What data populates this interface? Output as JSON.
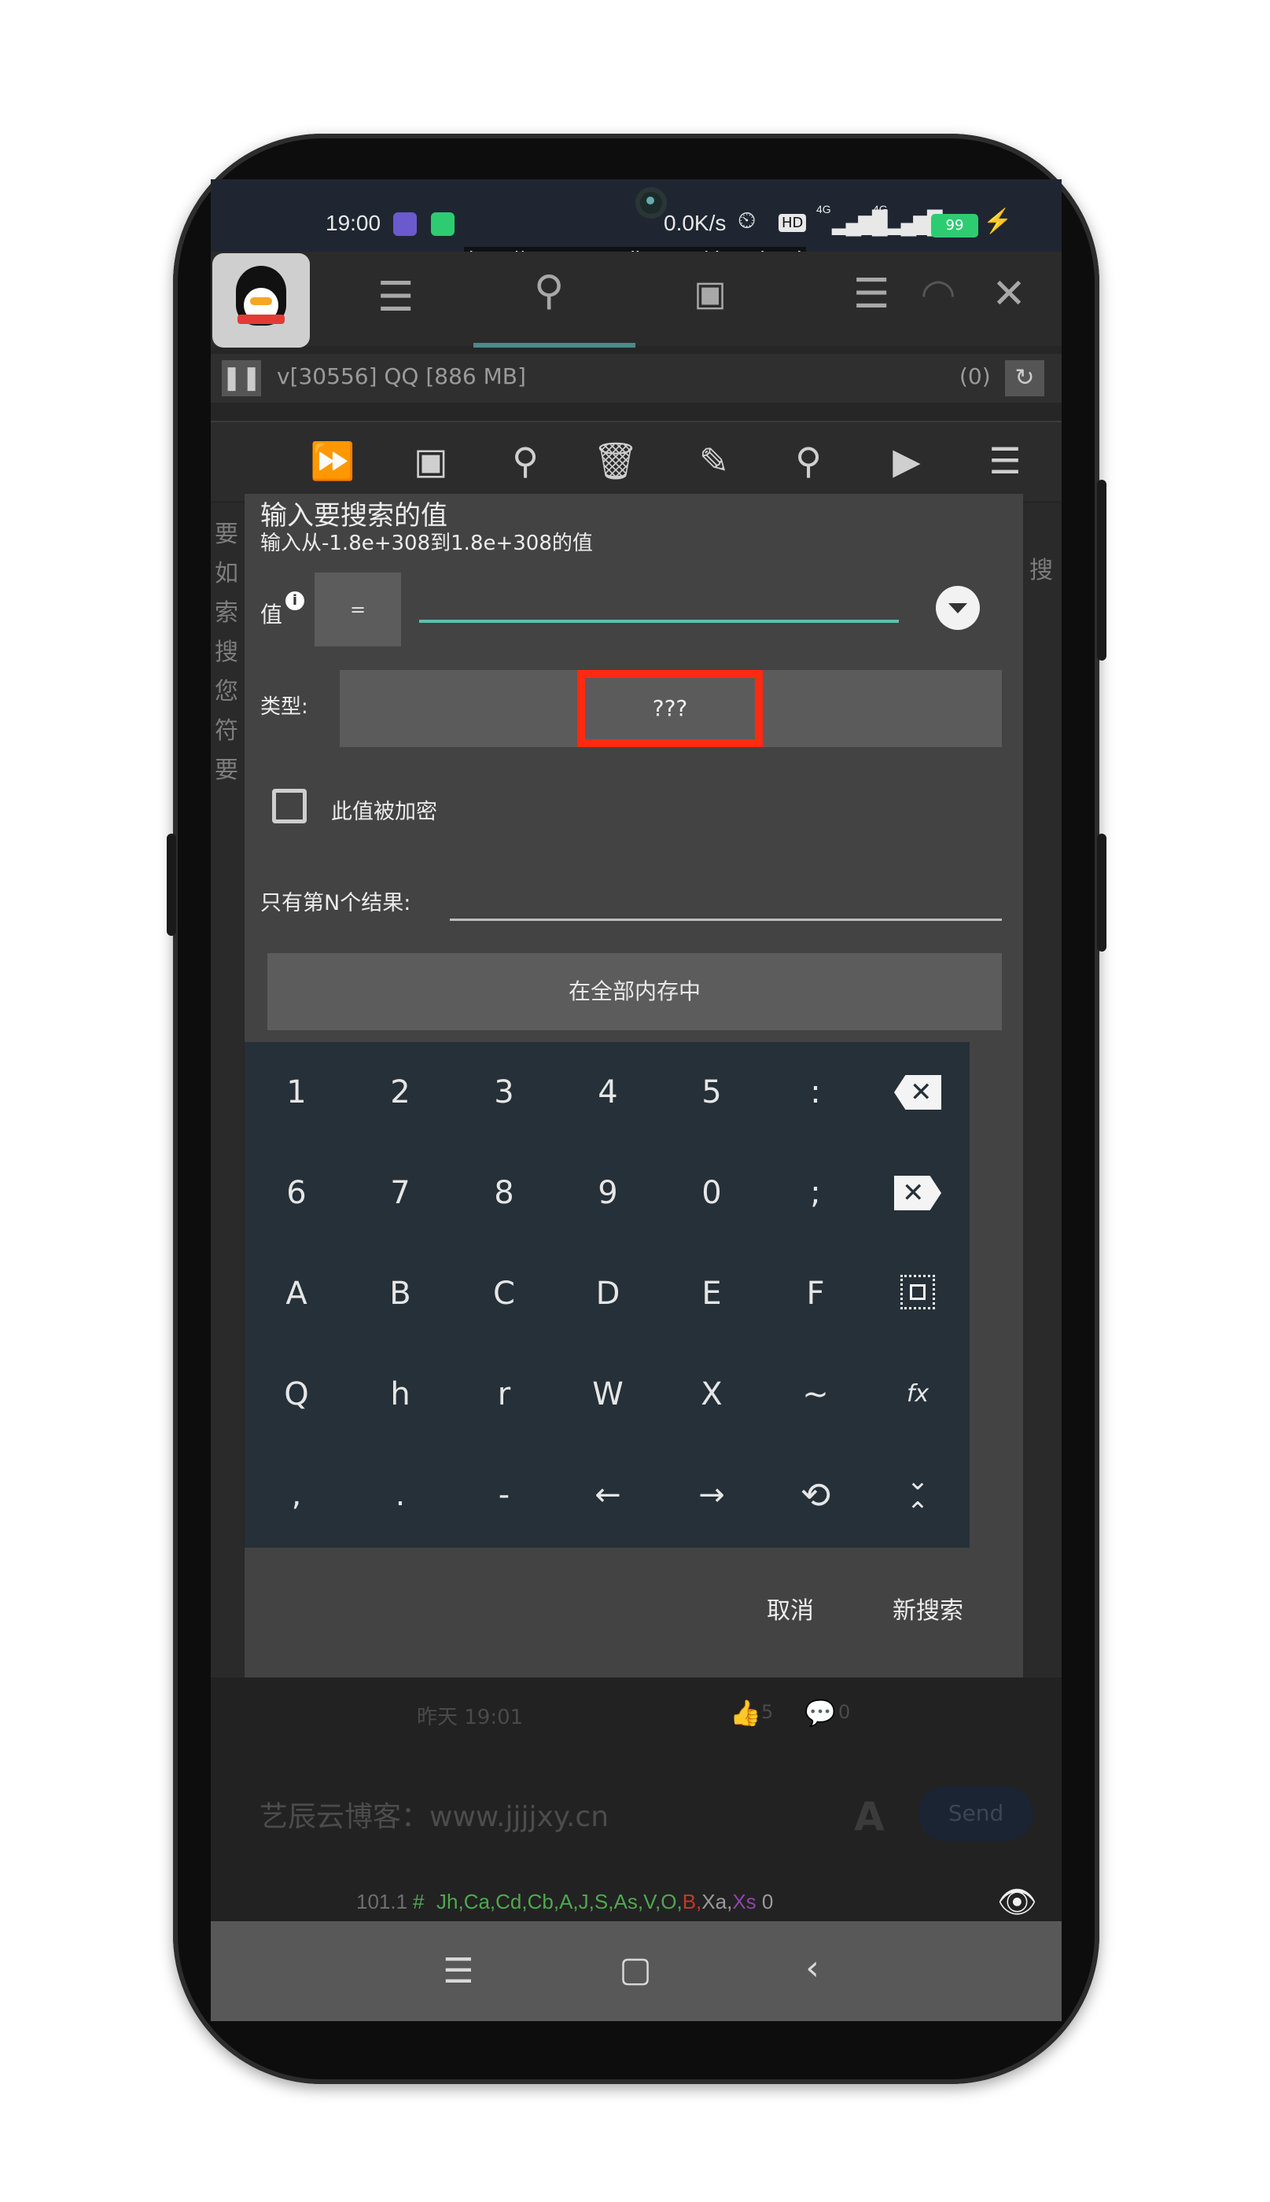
{
  "status_bar": {
    "time": "19:00",
    "speed": "0.0K/s",
    "network": "4G",
    "battery": "99"
  },
  "url_overlay": "http://gameguardian.net/download",
  "process": {
    "label": "v[30556] QQ [886 MB]",
    "count": "(0)"
  },
  "background_left_text": [
    "要",
    "如",
    "索",
    "搜",
    "您",
    "符",
    "要"
  ],
  "background_right_text": "搜",
  "dialog": {
    "title": "输入要搜索的值",
    "subtitle": "输入从-1.8e+308到1.8e+308的值",
    "value_label": "值",
    "operator": "=",
    "type_label": "类型:",
    "type_value": "???",
    "encrypted_label": "此值被加密",
    "nth_result_label": "只有第N个结果:",
    "memory_range_button": "在全部内存中",
    "cancel_button": "取消",
    "new_search_button": "新搜索"
  },
  "keyboard": {
    "rows": [
      [
        "1",
        "2",
        "3",
        "4",
        "5",
        ":",
        "backspace-icon"
      ],
      [
        "6",
        "7",
        "8",
        "9",
        "0",
        ";",
        "clear-icon"
      ],
      [
        "A",
        "B",
        "C",
        "D",
        "E",
        "F",
        "select-all-icon"
      ],
      [
        "Q",
        "h",
        "r",
        "W",
        "X",
        "~",
        "fx-icon"
      ],
      [
        ",",
        ".",
        "-",
        "←",
        "→",
        "history-icon",
        "collapse-icon"
      ]
    ],
    "fx_label": "fx"
  },
  "background_bottom": {
    "time_text": "昨天 19:01",
    "likes": "5",
    "comments": "0",
    "blog_text": "艺辰云博客：www.jjjjxy.cn",
    "send_button": "Send",
    "version": "101.1",
    "type_legend": [
      "Jh",
      "Ca",
      "Cd",
      "Cb",
      "A",
      "J",
      "S",
      "As",
      "V",
      "O",
      "B",
      "Xa",
      "Xs"
    ],
    "legend_colors": [
      "#4fa84f",
      "#4fa84f",
      "#4fa84f",
      "#4fa84f",
      "#4fa84f",
      "#4fa84f",
      "#4fa84f",
      "#4fa84f",
      "#4fa84f",
      "#4fa84f",
      "#c0392b",
      "#9a9a9a",
      "#8e44ad"
    ],
    "legend_count": "0"
  }
}
